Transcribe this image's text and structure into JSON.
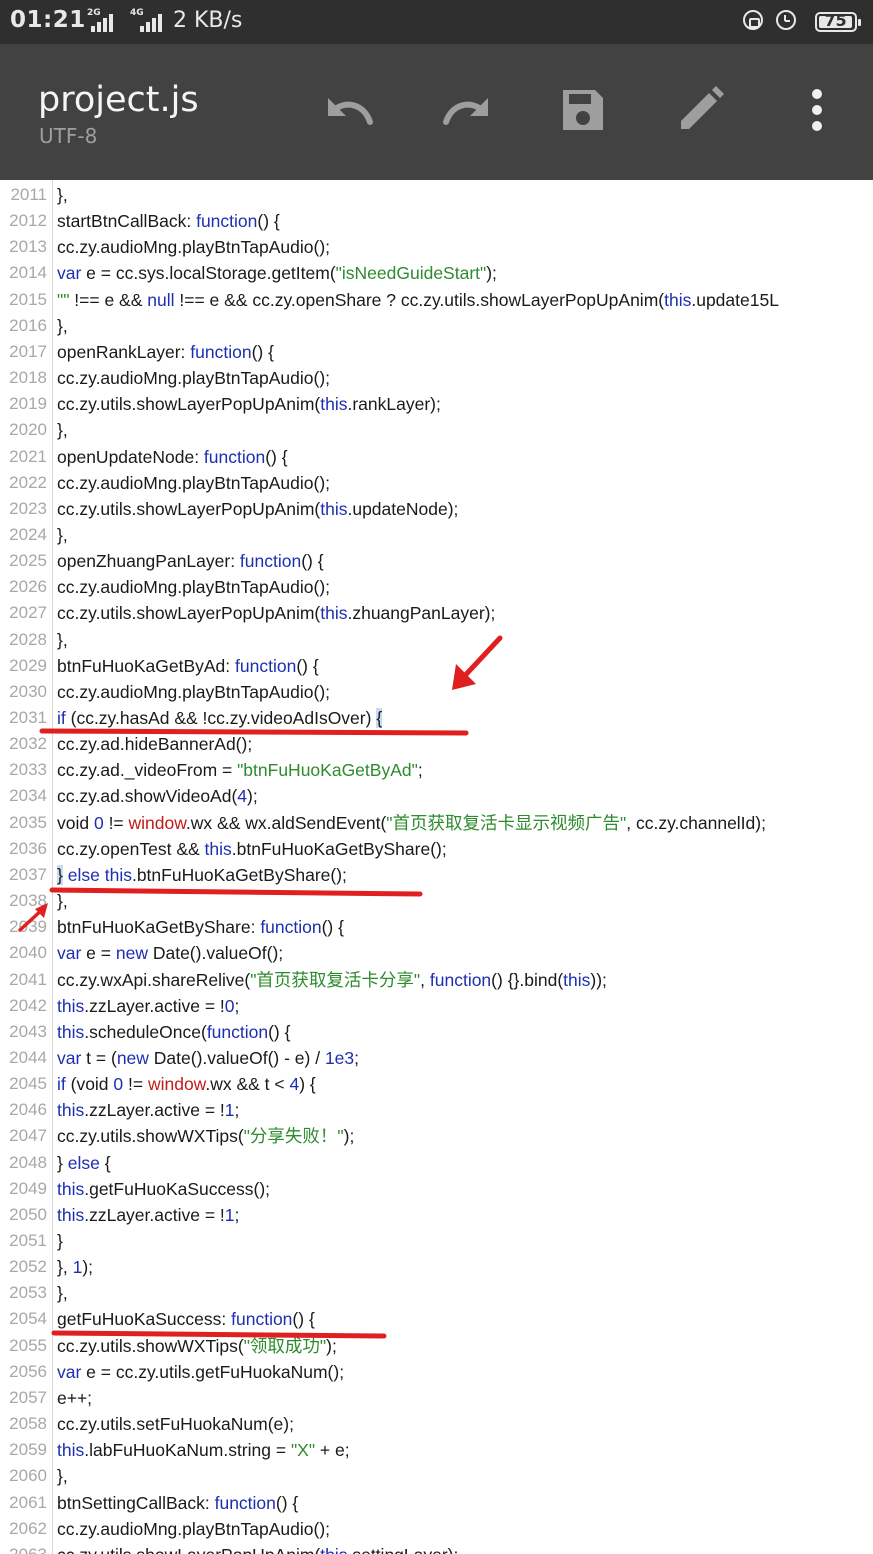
{
  "status_bar": {
    "time": "01:21",
    "signal1_label": "2G",
    "signal2_label": "4G",
    "speed": "2 KB/s",
    "battery": "75",
    "icons": [
      "signal-icon",
      "signal-icon",
      "rotation-lock-icon",
      "alarm-icon",
      "battery-icon"
    ]
  },
  "toolbar": {
    "title": "project.js",
    "encoding": "UTF-8",
    "actions": [
      "undo-icon",
      "redo-icon",
      "save-icon",
      "edit-icon",
      "more-vert-icon"
    ]
  },
  "colors": {
    "statusbar_bg": "#2f2f2f",
    "toolbar_bg": "#424242",
    "keyword": "#1d2fb0",
    "string": "#2e8b2e",
    "global": "#c41a1a",
    "annotation": "#e02020"
  },
  "lines": [
    {
      "n": "2011",
      "segs": [
        [
          "t",
          "},"
        ]
      ]
    },
    {
      "n": "2012",
      "segs": [
        [
          "t",
          "startBtnCallBack: "
        ],
        [
          "k",
          "function"
        ],
        [
          "t",
          "() {"
        ]
      ]
    },
    {
      "n": "2013",
      "segs": [
        [
          "t",
          "cc.zy.audioMng.playBtnTapAudio();"
        ]
      ]
    },
    {
      "n": "2014",
      "segs": [
        [
          "k",
          "var"
        ],
        [
          "t",
          " e = cc.sys.localStorage.getItem("
        ],
        [
          "s",
          "\"isNeedGuideStart\""
        ],
        [
          "t",
          ");"
        ]
      ]
    },
    {
      "n": "2015",
      "segs": [
        [
          "s",
          "\"\""
        ],
        [
          "t",
          " !== e && "
        ],
        [
          "k",
          "null"
        ],
        [
          "t",
          " !== e && cc.zy.openShare ? cc.zy.utils.showLayerPopUpAnim("
        ],
        [
          "k",
          "this"
        ],
        [
          "t",
          ".update15L"
        ]
      ]
    },
    {
      "n": "2016",
      "segs": [
        [
          "t",
          "},"
        ]
      ]
    },
    {
      "n": "2017",
      "segs": [
        [
          "t",
          "openRankLayer: "
        ],
        [
          "k",
          "function"
        ],
        [
          "t",
          "() {"
        ]
      ]
    },
    {
      "n": "2018",
      "segs": [
        [
          "t",
          "cc.zy.audioMng.playBtnTapAudio();"
        ]
      ]
    },
    {
      "n": "2019",
      "segs": [
        [
          "t",
          "cc.zy.utils.showLayerPopUpAnim("
        ],
        [
          "k",
          "this"
        ],
        [
          "t",
          ".rankLayer);"
        ]
      ]
    },
    {
      "n": "2020",
      "segs": [
        [
          "t",
          "},"
        ]
      ]
    },
    {
      "n": "2021",
      "segs": [
        [
          "t",
          "openUpdateNode: "
        ],
        [
          "k",
          "function"
        ],
        [
          "t",
          "() {"
        ]
      ]
    },
    {
      "n": "2022",
      "segs": [
        [
          "t",
          "cc.zy.audioMng.playBtnTapAudio();"
        ]
      ]
    },
    {
      "n": "2023",
      "segs": [
        [
          "t",
          "cc.zy.utils.showLayerPopUpAnim("
        ],
        [
          "k",
          "this"
        ],
        [
          "t",
          ".updateNode);"
        ]
      ]
    },
    {
      "n": "2024",
      "segs": [
        [
          "t",
          "},"
        ]
      ]
    },
    {
      "n": "2025",
      "segs": [
        [
          "t",
          "openZhuangPanLayer: "
        ],
        [
          "k",
          "function"
        ],
        [
          "t",
          "() {"
        ]
      ]
    },
    {
      "n": "2026",
      "segs": [
        [
          "t",
          "cc.zy.audioMng.playBtnTapAudio();"
        ]
      ]
    },
    {
      "n": "2027",
      "segs": [
        [
          "t",
          "cc.zy.utils.showLayerPopUpAnim("
        ],
        [
          "k",
          "this"
        ],
        [
          "t",
          ".zhuangPanLayer);"
        ]
      ]
    },
    {
      "n": "2028",
      "segs": [
        [
          "t",
          "},"
        ]
      ]
    },
    {
      "n": "2029",
      "segs": [
        [
          "t",
          "btnFuHuoKaGetByAd: "
        ],
        [
          "k",
          "function"
        ],
        [
          "t",
          "() {"
        ]
      ]
    },
    {
      "n": "2030",
      "segs": [
        [
          "t",
          "cc.zy.audioMng.playBtnTapAudio();"
        ]
      ]
    },
    {
      "n": "2031",
      "segs": [
        [
          "k",
          "if"
        ],
        [
          "t",
          " (cc.zy.hasAd && !cc.zy.videoAdIsOver) "
        ],
        [
          "h",
          "{"
        ]
      ]
    },
    {
      "n": "2032",
      "segs": [
        [
          "t",
          "cc.zy.ad.hideBannerAd();"
        ]
      ]
    },
    {
      "n": "2033",
      "segs": [
        [
          "t",
          "cc.zy.ad._videoFrom = "
        ],
        [
          "s",
          "\"btnFuHuoKaGetByAd\""
        ],
        [
          "t",
          ";"
        ]
      ]
    },
    {
      "n": "2034",
      "segs": [
        [
          "t",
          "cc.zy.ad.showVideoAd("
        ],
        [
          "n",
          "4"
        ],
        [
          "t",
          ");"
        ]
      ]
    },
    {
      "n": "2035",
      "segs": [
        [
          "t",
          "void "
        ],
        [
          "n",
          "0"
        ],
        [
          "t",
          " != "
        ],
        [
          "r",
          "window"
        ],
        [
          "t",
          ".wx && wx.aldSendEvent("
        ],
        [
          "s",
          "\"首页获取复活卡显示视频广告\""
        ],
        [
          "t",
          ", cc.zy.channelId);"
        ]
      ]
    },
    {
      "n": "2036",
      "segs": [
        [
          "t",
          "cc.zy.openTest && "
        ],
        [
          "k",
          "this"
        ],
        [
          "t",
          ".btnFuHuoKaGetByShare();"
        ]
      ]
    },
    {
      "n": "2037",
      "segs": [
        [
          "h",
          "}"
        ],
        [
          "t",
          " "
        ],
        [
          "k",
          "else"
        ],
        [
          "t",
          " "
        ],
        [
          "k",
          "this"
        ],
        [
          "t",
          ".btnFuHuoKaGetByShare();"
        ]
      ]
    },
    {
      "n": "2038",
      "segs": [
        [
          "t",
          "},"
        ]
      ]
    },
    {
      "n": "2039",
      "segs": [
        [
          "t",
          "btnFuHuoKaGetByShare: "
        ],
        [
          "k",
          "function"
        ],
        [
          "t",
          "() {"
        ]
      ]
    },
    {
      "n": "2040",
      "segs": [
        [
          "k",
          "var"
        ],
        [
          "t",
          " e = "
        ],
        [
          "k",
          "new"
        ],
        [
          "t",
          " Date().valueOf();"
        ]
      ]
    },
    {
      "n": "2041",
      "segs": [
        [
          "t",
          "cc.zy.wxApi.shareRelive("
        ],
        [
          "s",
          "\"首页获取复活卡分享\""
        ],
        [
          "t",
          ", "
        ],
        [
          "k",
          "function"
        ],
        [
          "t",
          "() {}.bind("
        ],
        [
          "k",
          "this"
        ],
        [
          "t",
          "));"
        ]
      ]
    },
    {
      "n": "2042",
      "segs": [
        [
          "k",
          "this"
        ],
        [
          "t",
          ".zzLayer.active = !"
        ],
        [
          "n",
          "0"
        ],
        [
          "t",
          ";"
        ]
      ]
    },
    {
      "n": "2043",
      "segs": [
        [
          "k",
          "this"
        ],
        [
          "t",
          ".scheduleOnce("
        ],
        [
          "k",
          "function"
        ],
        [
          "t",
          "() {"
        ]
      ]
    },
    {
      "n": "2044",
      "segs": [
        [
          "k",
          "var"
        ],
        [
          "t",
          " t = ("
        ],
        [
          "k",
          "new"
        ],
        [
          "t",
          " Date().valueOf() - e) / "
        ],
        [
          "n",
          "1e3"
        ],
        [
          "t",
          ";"
        ]
      ]
    },
    {
      "n": "2045",
      "segs": [
        [
          "k",
          "if"
        ],
        [
          "t",
          " (void "
        ],
        [
          "n",
          "0"
        ],
        [
          "t",
          " != "
        ],
        [
          "r",
          "window"
        ],
        [
          "t",
          ".wx && t < "
        ],
        [
          "n",
          "4"
        ],
        [
          "t",
          ") {"
        ]
      ]
    },
    {
      "n": "2046",
      "segs": [
        [
          "k",
          "this"
        ],
        [
          "t",
          ".zzLayer.active = !"
        ],
        [
          "n",
          "1"
        ],
        [
          "t",
          ";"
        ]
      ]
    },
    {
      "n": "2047",
      "segs": [
        [
          "t",
          "cc.zy.utils.showWXTips("
        ],
        [
          "s",
          "\"分享失败！\""
        ],
        [
          "t",
          ");"
        ]
      ]
    },
    {
      "n": "2048",
      "segs": [
        [
          "t",
          "} "
        ],
        [
          "k",
          "else"
        ],
        [
          "t",
          " {"
        ]
      ]
    },
    {
      "n": "2049",
      "segs": [
        [
          "k",
          "this"
        ],
        [
          "t",
          ".getFuHuoKaSuccess();"
        ]
      ]
    },
    {
      "n": "2050",
      "segs": [
        [
          "k",
          "this"
        ],
        [
          "t",
          ".zzLayer.active = !"
        ],
        [
          "n",
          "1"
        ],
        [
          "t",
          ";"
        ]
      ]
    },
    {
      "n": "2051",
      "segs": [
        [
          "t",
          "}"
        ]
      ]
    },
    {
      "n": "2052",
      "segs": [
        [
          "t",
          "}, "
        ],
        [
          "n",
          "1"
        ],
        [
          "t",
          ");"
        ]
      ]
    },
    {
      "n": "2053",
      "segs": [
        [
          "t",
          "},"
        ]
      ]
    },
    {
      "n": "2054",
      "segs": [
        [
          "t",
          "getFuHuoKaSuccess: "
        ],
        [
          "k",
          "function"
        ],
        [
          "t",
          "() {"
        ]
      ]
    },
    {
      "n": "2055",
      "segs": [
        [
          "t",
          "cc.zy.utils.showWXTips("
        ],
        [
          "s",
          "\"领取成功\""
        ],
        [
          "t",
          ");"
        ]
      ]
    },
    {
      "n": "2056",
      "segs": [
        [
          "k",
          "var"
        ],
        [
          "t",
          " e = cc.zy.utils.getFuHuokaNum();"
        ]
      ]
    },
    {
      "n": "2057",
      "segs": [
        [
          "t",
          "e++;"
        ]
      ]
    },
    {
      "n": "2058",
      "segs": [
        [
          "t",
          "cc.zy.utils.setFuHuokaNum(e);"
        ]
      ]
    },
    {
      "n": "2059",
      "segs": [
        [
          "k",
          "this"
        ],
        [
          "t",
          ".labFuHuoKaNum.string = "
        ],
        [
          "s",
          "\"X\""
        ],
        [
          "t",
          " + e;"
        ]
      ]
    },
    {
      "n": "2060",
      "segs": [
        [
          "t",
          "},"
        ]
      ]
    },
    {
      "n": "2061",
      "segs": [
        [
          "t",
          "btnSettingCallBack: "
        ],
        [
          "k",
          "function"
        ],
        [
          "t",
          "() {"
        ]
      ]
    },
    {
      "n": "2062",
      "segs": [
        [
          "t",
          "cc.zy.audioMng.playBtnTapAudio();"
        ]
      ]
    },
    {
      "n": "2063",
      "segs": [
        [
          "t",
          "cc.zy.utils.showLayerPopUpAnim("
        ],
        [
          "k",
          "this"
        ],
        [
          "t",
          ".settingLayer);"
        ]
      ]
    }
  ]
}
